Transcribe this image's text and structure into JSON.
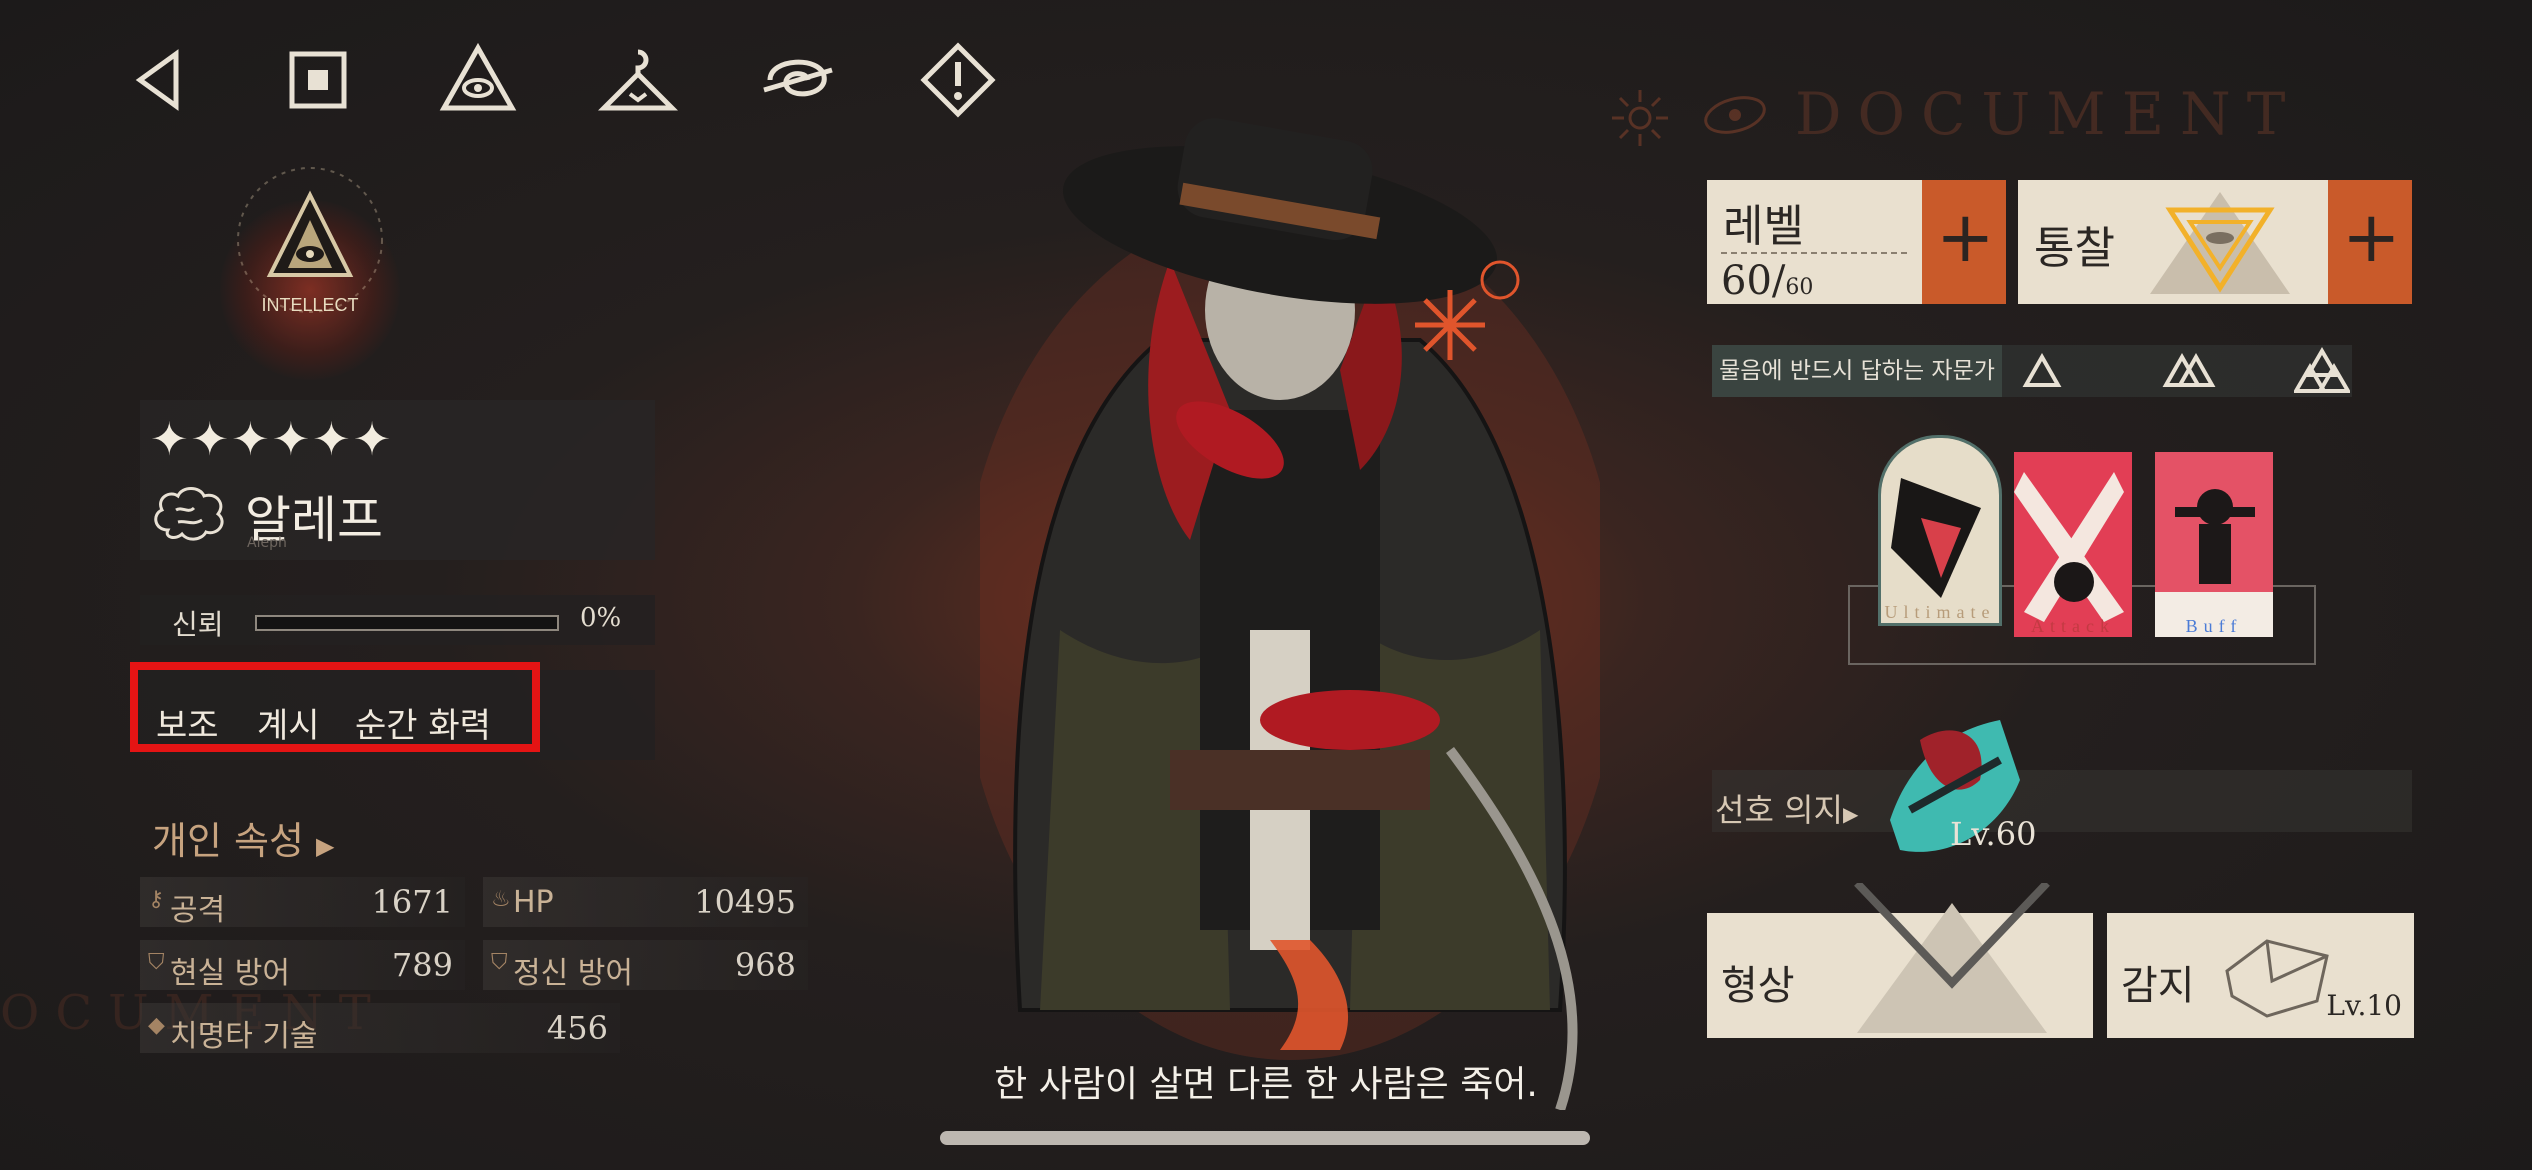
{
  "toolbar": {
    "icons": [
      "back-icon",
      "stop-icon",
      "eye-triangle-icon",
      "hanger-icon",
      "swirl-icon",
      "warning-icon"
    ]
  },
  "background": {
    "document_text": "DOCUMENT",
    "document_text_left": "OCUMENT"
  },
  "emblem": {
    "label": "INTELLECT"
  },
  "character": {
    "stars": "✦✦✦✦✦✦",
    "name": "알레프",
    "name_en": "Aleph",
    "trust_label": "신뢰",
    "trust_value": "0%",
    "trust_progress": 0,
    "tags": [
      "보조",
      "계시",
      "순간 화력"
    ]
  },
  "attributes": {
    "title": "개인 속성",
    "stats": [
      {
        "label": "공격",
        "value": "1671"
      },
      {
        "label": "HP",
        "value": "10495"
      },
      {
        "label": "현실 방어",
        "value": "789"
      },
      {
        "label": "정신 방어",
        "value": "968"
      },
      {
        "label": "치명타 기술",
        "value": "456"
      }
    ]
  },
  "subtitle": "한 사람이 살면 다른 한 사람은 죽어.",
  "right": {
    "level_label": "레벨",
    "level_value": "60/",
    "level_max": "60",
    "insight_label": "통찰",
    "title_label": "물음에 반드시 답하는 자문가",
    "cards": [
      "Ultimate",
      "Attack",
      "Buff"
    ],
    "pref_label": "선호 의지",
    "pref_level": "Lv.60",
    "form_label": "형상",
    "sense_label": "감지",
    "sense_level": "Lv.10"
  },
  "colors": {
    "accent_orange": "#c95a2a",
    "highlight_red": "#e41414",
    "card_bg": "#e9e0cf"
  }
}
